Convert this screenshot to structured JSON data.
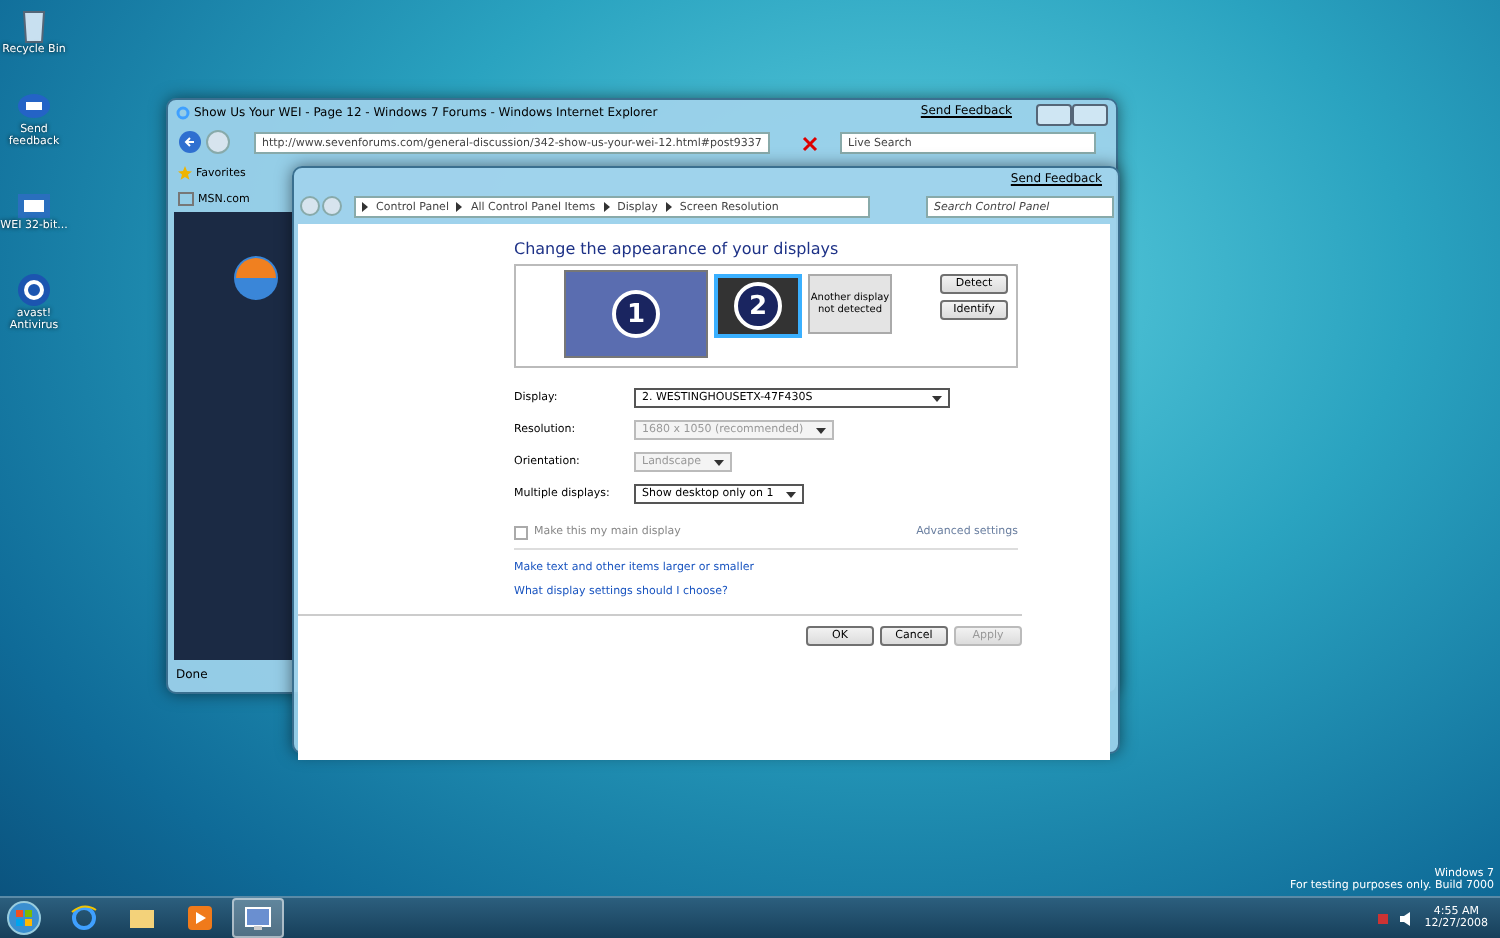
{
  "desktop_icons": [
    {
      "label": "Recycle Bin",
      "kind": "bin"
    },
    {
      "label": "Send feedback",
      "kind": "feedback"
    },
    {
      "label": "WEI 32-bit...",
      "kind": "file"
    },
    {
      "label": "avast! Antivirus",
      "kind": "antivirus"
    }
  ],
  "ie_window": {
    "title": "Show Us Your WEI - Page 12 - Windows 7 Forums - Windows Internet Explorer",
    "send_feedback": "Send Feedback",
    "address": "http://www.sevenforums.com/general-discussion/342-show-us-your-wei-12.html#post9337",
    "search_placeholder": "Live Search",
    "favorites": "Favorites",
    "tab": "MSN.com",
    "status": "Done"
  },
  "cp_window": {
    "send_feedback": "Send Feedback",
    "breadcrumb": [
      "Control Panel",
      "All Control Panel Items",
      "Display",
      "Screen Resolution"
    ],
    "search_placeholder": "Search Control Panel",
    "heading": "Change the appearance of your displays",
    "monitors": [
      {
        "number": "1",
        "selected": false
      },
      {
        "number": "2",
        "selected": true
      }
    ],
    "not_detected": "Another display not detected",
    "detect": "Detect",
    "identify": "Identify",
    "settings": [
      {
        "label": "Display:",
        "value": "2. WESTINGHOUSETX-47F430S",
        "disabled": false
      },
      {
        "label": "Resolution:",
        "value": "1680 x 1050 (recommended)",
        "disabled": true
      },
      {
        "label": "Orientation:",
        "value": "Landscape",
        "disabled": true
      },
      {
        "label": "Multiple displays:",
        "value": "Show desktop only on 1",
        "disabled": false
      }
    ],
    "main_display": {
      "label": "Make this my main display",
      "checked": false,
      "disabled": true
    },
    "advanced": "Advanced settings",
    "links": [
      "Make text and other items larger or smaller",
      "What display settings should I choose?"
    ],
    "buttons": [
      {
        "label": "OK",
        "disabled": false
      },
      {
        "label": "Cancel",
        "disabled": false
      },
      {
        "label": "Apply",
        "disabled": true
      }
    ]
  },
  "taskbar": {
    "items": [
      {
        "kind": "ie",
        "selected": false
      },
      {
        "kind": "explorer",
        "selected": false
      },
      {
        "kind": "media",
        "selected": false
      },
      {
        "kind": "control",
        "selected": true
      }
    ]
  },
  "os_notice": [
    "Windows 7",
    "For testing purposes only. Build 7000"
  ],
  "clock": {
    "time": "4:55 AM",
    "date": "12/27/2008"
  }
}
